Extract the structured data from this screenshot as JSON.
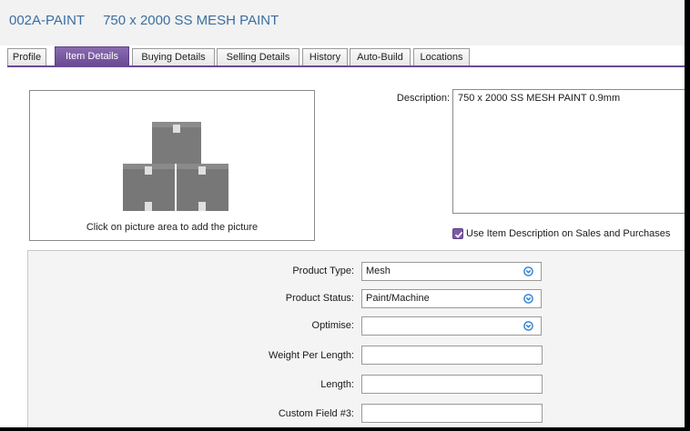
{
  "header": {
    "item_code": "002A-PAINT",
    "item_name": "750 x 2000 SS MESH PAINT"
  },
  "tabs": [
    {
      "label": "Profile",
      "active": false
    },
    {
      "label": "Item Details",
      "active": true
    },
    {
      "label": "Buying Details",
      "active": false
    },
    {
      "label": "Selling Details",
      "active": false
    },
    {
      "label": "History",
      "active": false
    },
    {
      "label": "Auto-Build",
      "active": false
    },
    {
      "label": "Locations",
      "active": false
    }
  ],
  "picture": {
    "icon": "boxes-placeholder-icon",
    "caption": "Click on picture area to add the picture"
  },
  "description": {
    "label": "Description:",
    "value": "750 x 2000 SS MESH PAINT 0.9mm"
  },
  "use_item_description": {
    "label": "Use Item Description on Sales and Purchases",
    "checked": true
  },
  "fields": {
    "product_type": {
      "label": "Product Type:",
      "value": "Mesh"
    },
    "product_status": {
      "label": "Product Status:",
      "value": "Paint/Machine"
    },
    "optimise": {
      "label": "Optimise:",
      "value": ""
    },
    "weight_per_length": {
      "label": "Weight Per Length:",
      "value": ""
    },
    "length": {
      "label": "Length:",
      "value": ""
    },
    "custom_field_3": {
      "label": "Custom Field #3:",
      "value": ""
    }
  },
  "colors": {
    "title": "#3b6ea0",
    "active_tab": "#6a4a93",
    "dropdown_icon": "#2e7fd0"
  }
}
